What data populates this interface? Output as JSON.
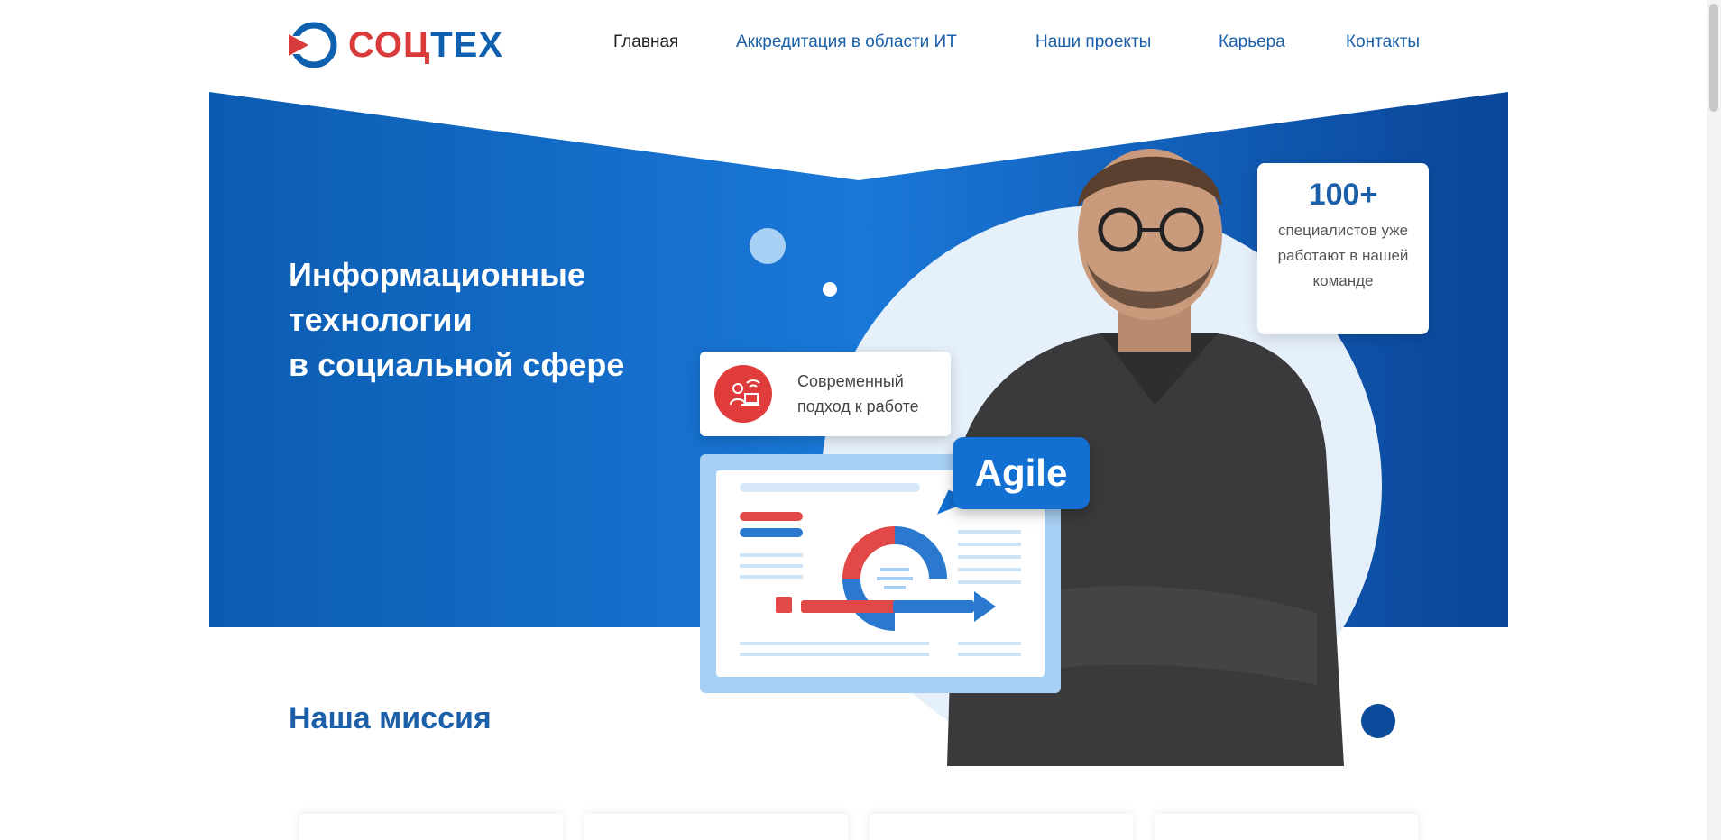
{
  "brand": {
    "name_part_a": "СОЦ",
    "name_part_b": "ТЕХ",
    "red": "#d93a3a",
    "blue": "#1060b0"
  },
  "nav": {
    "items": [
      {
        "label": "Главная",
        "active": true
      },
      {
        "label": "Аккредитация в области ИТ",
        "active": false
      },
      {
        "label": "Наши проекты",
        "active": false
      },
      {
        "label": "Карьера",
        "active": false
      },
      {
        "label": "Контакты",
        "active": false
      }
    ]
  },
  "hero": {
    "title_lines": [
      "Информационные",
      "технологии",
      "в социальной сфере"
    ],
    "bg_color": "#0a5aad"
  },
  "stat": {
    "number": "100+",
    "description": "специалистов уже работают в нашей команде"
  },
  "approach": {
    "icon": "remote-work-icon",
    "line1": "Современный",
    "line2": "подход к работе"
  },
  "agile": {
    "label": "Agile"
  },
  "mission": {
    "title": "Наша миссия"
  }
}
